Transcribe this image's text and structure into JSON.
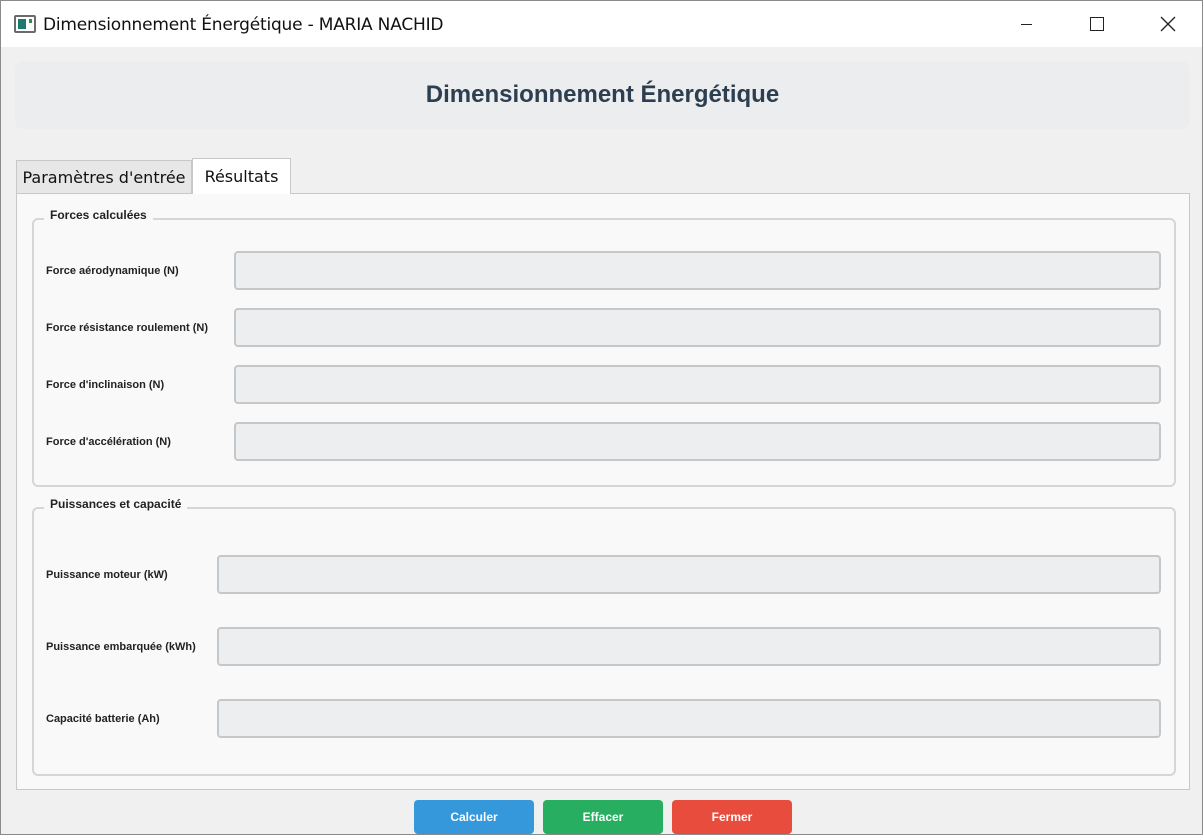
{
  "window": {
    "title": "Dimensionnement Énergétique - MARIA NACHID"
  },
  "header": {
    "title": "Dimensionnement Énergétique"
  },
  "tabs": [
    {
      "label": "Paramètres d'entrée",
      "active": false
    },
    {
      "label": "Résultats",
      "active": true
    }
  ],
  "forces_group": {
    "title": "Forces calculées",
    "rows": [
      {
        "label": "Force aérodynamique (N)",
        "value": ""
      },
      {
        "label": "Force résistance roulement (N)",
        "value": ""
      },
      {
        "label": "Force d'inclinaison (N)",
        "value": ""
      },
      {
        "label": "Force d'accélération (N)",
        "value": ""
      }
    ]
  },
  "power_group": {
    "title": "Puissances et capacité",
    "rows": [
      {
        "label": "Puissance moteur (kW)",
        "value": ""
      },
      {
        "label": "Puissance embarquée (kWh)",
        "value": ""
      },
      {
        "label": "Capacité batterie (Ah)",
        "value": ""
      }
    ]
  },
  "buttons": {
    "calculate": "Calculer",
    "clear": "Effacer",
    "close": "Fermer"
  },
  "colors": {
    "calculate": "#3498db",
    "clear": "#27ae60",
    "close": "#e74c3c",
    "header_text": "#2c3e50"
  }
}
